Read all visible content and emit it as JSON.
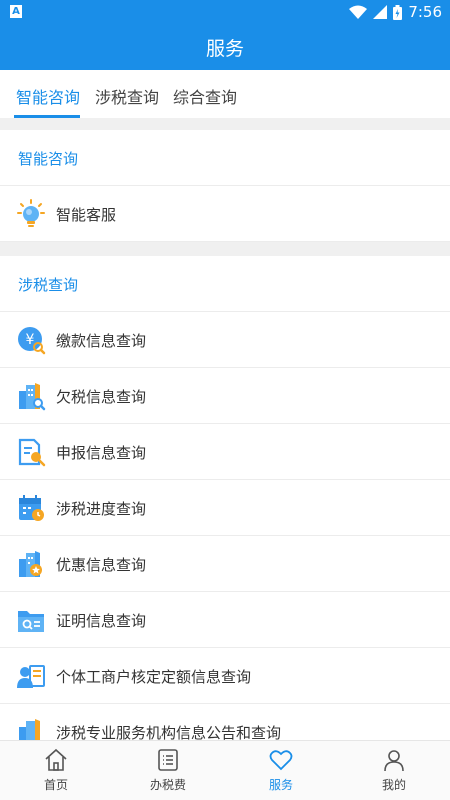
{
  "status": {
    "app_badge": "A",
    "time": "7:56"
  },
  "appbar": {
    "title": "服务"
  },
  "tabs": [
    {
      "label": "智能咨询",
      "active": true
    },
    {
      "label": "涉税查询",
      "active": false
    },
    {
      "label": "综合查询",
      "active": false
    }
  ],
  "sections": {
    "smart": {
      "header": "智能咨询",
      "items": [
        {
          "label": "智能客服",
          "icon": "lightbulb-icon"
        }
      ]
    },
    "tax": {
      "header": "涉税查询",
      "items": [
        {
          "label": "缴款信息查询",
          "icon": "yuan-search-icon"
        },
        {
          "label": "欠税信息查询",
          "icon": "building-search-icon"
        },
        {
          "label": "申报信息查询",
          "icon": "document-search-icon"
        },
        {
          "label": "涉税进度查询",
          "icon": "calendar-clock-icon"
        },
        {
          "label": "优惠信息查询",
          "icon": "building-star-icon"
        },
        {
          "label": "证明信息查询",
          "icon": "folder-search-icon"
        },
        {
          "label": "个体工商户核定定额信息查询",
          "icon": "person-card-icon"
        },
        {
          "label": "涉税专业服务机构信息公告和查询",
          "icon": "building-icon"
        }
      ]
    }
  },
  "bottom_nav": [
    {
      "label": "首页",
      "icon": "home-icon",
      "active": false
    },
    {
      "label": "办税费",
      "icon": "list-icon",
      "active": false
    },
    {
      "label": "服务",
      "icon": "heart-icon",
      "active": true
    },
    {
      "label": "我的",
      "icon": "user-icon",
      "active": false
    }
  ],
  "colors": {
    "primary": "#1a8ee8",
    "accent_orange": "#f5a623",
    "background_gap": "#f0f0f0"
  }
}
